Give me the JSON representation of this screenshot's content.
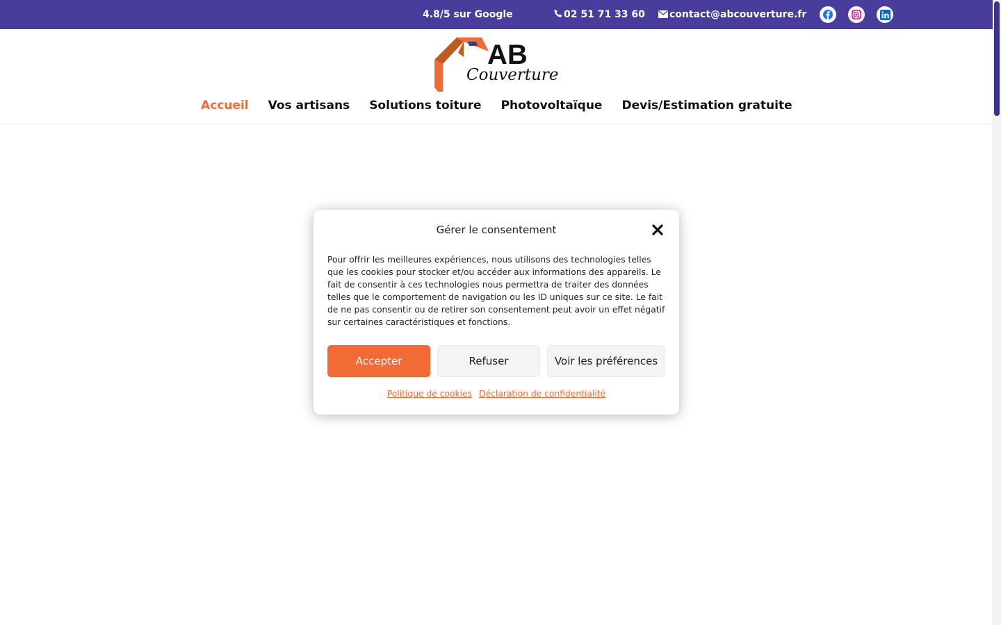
{
  "topbar": {
    "rating_stars": "",
    "rating_text": "4.8/5 sur Google",
    "phone": "02 51 71 33 60",
    "email": "contact@abcouverture.fr",
    "social": [
      {
        "name": "facebook-icon",
        "color": "#1877f2"
      },
      {
        "name": "instagram-icon",
        "color": "#d6249f"
      },
      {
        "name": "linkedin-icon",
        "color": "#0a66c2"
      }
    ],
    "background": "#483d9b"
  },
  "header": {
    "logo": {
      "line1": "AB",
      "line2": "Couverture"
    },
    "nav": [
      {
        "label": "Accueil",
        "active": true
      },
      {
        "label": "Vos artisans",
        "active": false
      },
      {
        "label": "Solutions toiture",
        "active": false
      },
      {
        "label": "Photovoltaïque",
        "active": false
      },
      {
        "label": "Devis/Estimation gratuite",
        "active": false
      }
    ]
  },
  "consent": {
    "title": "Gérer le consentement",
    "text": "Pour offrir les meilleures expériences, nous utilisons des technologies telles que les cookies pour stocker et/ou accéder aux informations des appareils. Le fait de consentir à ces technologies nous permettra de traiter des données telles que le comportement de navigation ou les ID uniques sur ce site. Le fait de ne pas consentir ou de retirer son consentement peut avoir un effet négatif sur certaines caractéristiques et fonctions.",
    "accept_label": "Accepter",
    "refuse_label": "Refuser",
    "prefs_label": "Voir les préférences",
    "cookie_policy_label": "Politique de cookies",
    "privacy_label": "Déclaration de confidentialité"
  },
  "colors": {
    "accent": "#f26a35",
    "brand": "#483d9b"
  }
}
